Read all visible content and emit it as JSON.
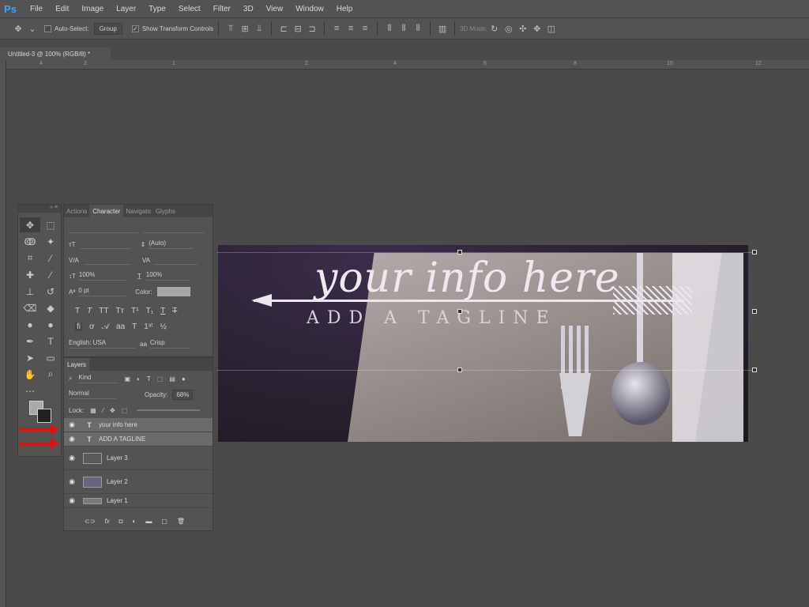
{
  "menubar": {
    "logo": "Ps",
    "items": [
      "File",
      "Edit",
      "Image",
      "Layer",
      "Type",
      "Select",
      "Filter",
      "3D",
      "View",
      "Window",
      "Help"
    ]
  },
  "options": {
    "autoselect_label": "Auto-Select:",
    "autoselect_value": "Group",
    "show_transform_label": "Show Transform Controls",
    "mode_3d_label": "3D Mode:"
  },
  "document": {
    "tab_title": "Untitled-3 @ 100% (RGB/8) *"
  },
  "ruler": {
    "marks": [
      "4",
      "2",
      "1",
      "2",
      "4",
      "6",
      "8",
      "10",
      "12"
    ]
  },
  "char_panel": {
    "tabs": [
      "Actions",
      "Character",
      "Navigato",
      "Glyphs"
    ],
    "font_size_label": "",
    "leading_value": "(Auto)",
    "vertical_scale": "100%",
    "horizontal_scale": "100%",
    "baseline": "0 pt",
    "color_label": "Color:",
    "language": "English: USA",
    "antialias": "Crisp"
  },
  "layers_panel": {
    "title": "Layers",
    "kind_label": "Kind",
    "blend_mode": "Normal",
    "opacity_label": "Opacity:",
    "opacity_value": "68%",
    "lock_label": "Lock:",
    "layers": [
      {
        "type": "T",
        "name": "your info here",
        "selected": true
      },
      {
        "type": "T",
        "name": "ADD A TAGLINE",
        "selected": true
      },
      {
        "type": "img",
        "name": "Layer 3",
        "selected": false
      },
      {
        "type": "img",
        "name": "Layer 2",
        "selected": false
      },
      {
        "type": "img",
        "name": "Layer 1",
        "selected": false
      }
    ]
  },
  "canvas": {
    "headline": "your info here",
    "tagline": "ADD A TAGLINE"
  },
  "colors": {
    "accent_red": "#e01010",
    "ps_blue": "#31a8ff"
  }
}
